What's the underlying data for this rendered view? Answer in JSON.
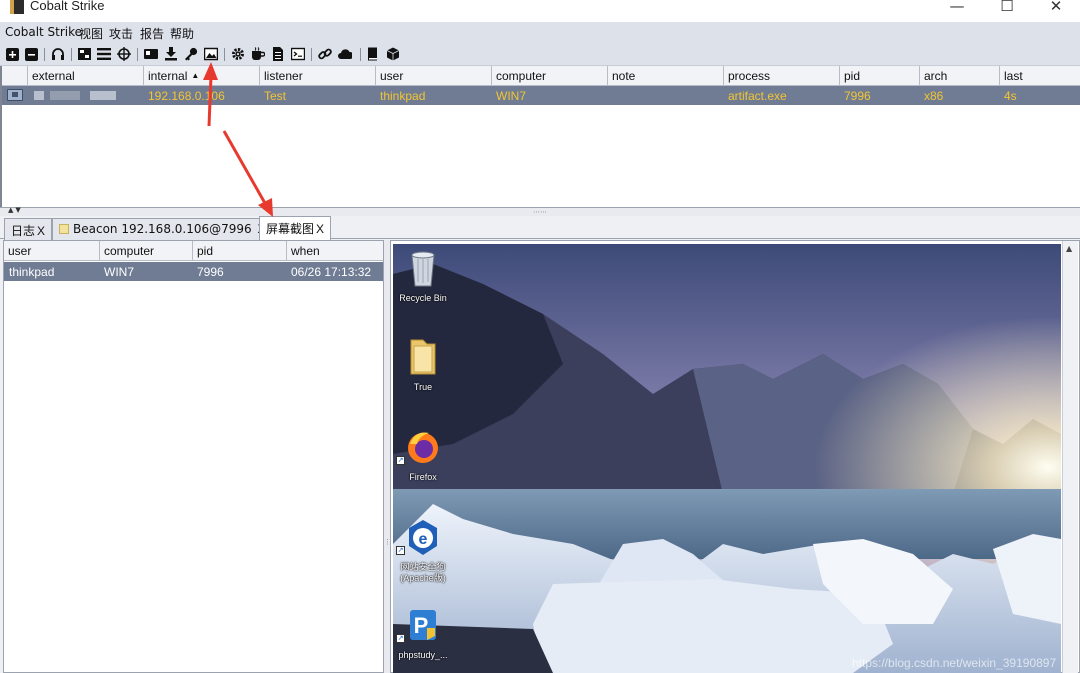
{
  "window": {
    "title": "Cobalt Strike",
    "controls": [
      "—",
      "☐",
      "✕"
    ]
  },
  "menubar": {
    "items": [
      "Cobalt Strike",
      "视图",
      "攻击",
      "报告",
      "帮助"
    ]
  },
  "toolbar": {
    "icons": [
      "plus-icon",
      "minus-icon",
      "headphones-icon",
      "pivot-graph-icon",
      "session-table-icon",
      "targets-icon",
      "credentials-icon",
      "downloads-icon",
      "keystrokes-icon",
      "screenshots-icon",
      "settings-icon",
      "coffee-icon",
      "notes-icon",
      "console-icon",
      "link-icon",
      "cloud-icon",
      "book-icon",
      "cube-icon"
    ]
  },
  "beacons_table": {
    "columns": [
      "external",
      "internal",
      "listener",
      "user",
      "computer",
      "note",
      "process",
      "pid",
      "arch",
      "last"
    ],
    "sorted_column": "internal",
    "sort_direction": "ascending",
    "rows": [
      {
        "external": "",
        "internal": "192.168.0.106",
        "listener": "Test",
        "user": "thinkpad",
        "computer": "WIN7",
        "note": "",
        "process": "artifact.exe",
        "pid": "7996",
        "arch": "x86",
        "last": "4s"
      }
    ]
  },
  "tabs": [
    {
      "label": "日志",
      "close": "X"
    },
    {
      "label": "Beacon 192.168.0.106@7996",
      "close": "X"
    },
    {
      "label": "屏幕截图",
      "close": "X",
      "active": true
    }
  ],
  "screenshots": {
    "columns": [
      "user",
      "computer",
      "pid",
      "when"
    ],
    "rows": [
      {
        "user": "thinkpad",
        "computer": "WIN7",
        "pid": "7996",
        "when": "06/26 17:13:32"
      }
    ]
  },
  "desktop_icons": [
    {
      "label": "Recycle Bin",
      "icon": "recycle-bin-icon"
    },
    {
      "label": "True",
      "icon": "folder-icon"
    },
    {
      "label": "Firefox",
      "icon": "firefox-icon"
    },
    {
      "label": "网站安全狗",
      "label2": "(Apache版)",
      "icon": "safedog-icon"
    },
    {
      "label": "phpstudy_...",
      "icon": "phpstudy-icon"
    }
  ],
  "watermark": "https://blog.csdn.net/weixin_39190897",
  "colors": {
    "selected_row": "#6f7c93",
    "beacon_text": "#f3c533",
    "annotation_arrow": "#e8392e"
  }
}
